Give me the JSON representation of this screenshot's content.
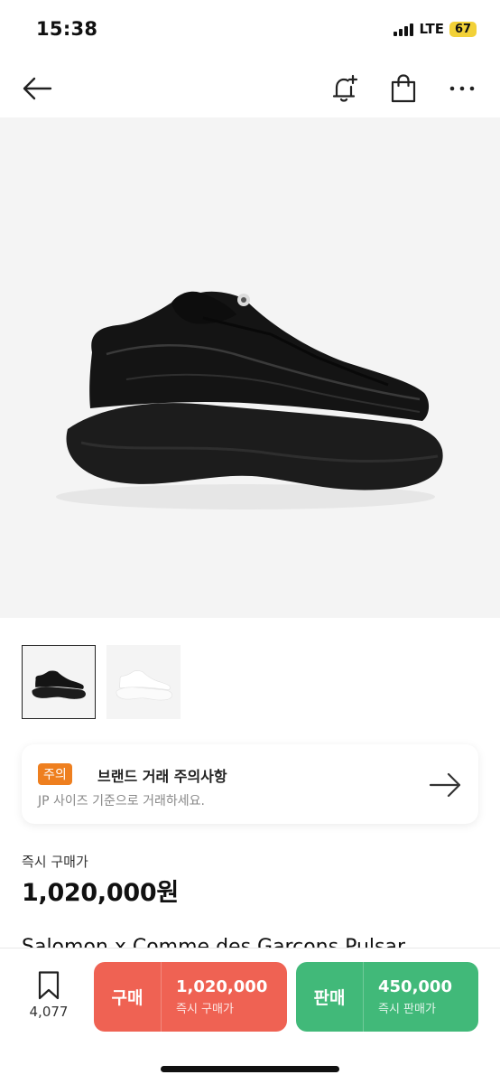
{
  "status_bar": {
    "time": "15:38",
    "network": "LTE",
    "battery": "67"
  },
  "nav": {
    "back_icon": "arrow-left-icon",
    "icons": [
      "bell-plus-icon",
      "shopping-bag-icon",
      "more-icon"
    ]
  },
  "product": {
    "image": "black-platform-sneaker",
    "thumbnails": [
      "black-sneaker-thumbnail",
      "white-sneaker-thumbnail"
    ],
    "name": "Salomon x Comme des Garcons Pulsar"
  },
  "notice": {
    "badge": "주의",
    "title": "브랜드 거래 주의사항",
    "description": "JP 사이즈 기준으로 거래하세요."
  },
  "price": {
    "label": "즉시 구매가",
    "value": "1,020,000원"
  },
  "bottom_bar": {
    "wish_count": "4,077",
    "buy": {
      "label": "구매",
      "price": "1,020,000",
      "sub": "즉시 구매가",
      "color": "#ef6253"
    },
    "sell": {
      "label": "판매",
      "price": "450,000",
      "sub": "즉시 판매가",
      "color": "#41b979"
    }
  },
  "colors": {
    "badge": "#ee7f1f",
    "image_bg": "#f4f4f4"
  }
}
